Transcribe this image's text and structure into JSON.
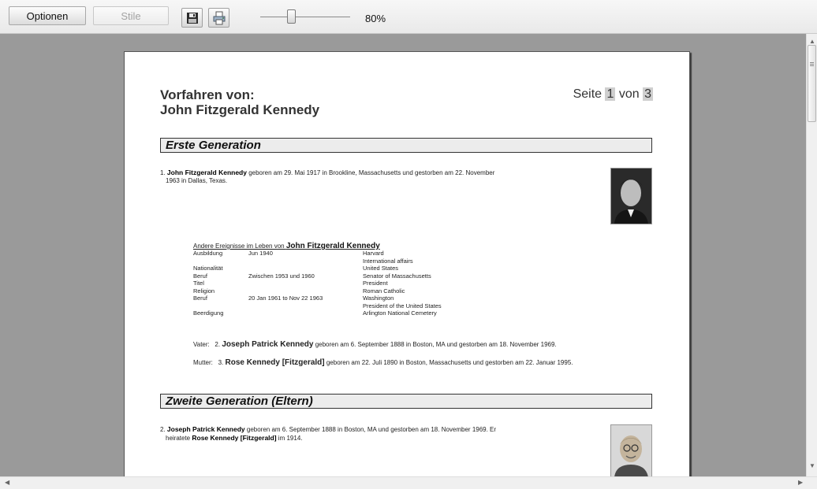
{
  "toolbar": {
    "options_label": "Optionen",
    "styles_label": "Stile",
    "save_icon": "floppy-disk-icon",
    "print_icon": "printer-icon",
    "zoom_value": 0.8,
    "zoom_label": "80%"
  },
  "document": {
    "title_prefix": "Vorfahren von:",
    "title_name": "John Fitzgerald Kennedy",
    "page_word": "Seite",
    "page_current": "1",
    "page_of": "von",
    "page_total": "3",
    "generations": [
      {
        "heading": "Erste Generation",
        "person": {
          "number": "1.",
          "name": "John Fitzgerald Kennedy",
          "text_line1": " geboren am 29. Mai 1917 in Brookline, Massachusetts und gestorben am 22. November",
          "text_line2": "1963 in Dallas, Texas."
        },
        "events_heading_prefix": "Andere Ereignisse im Leben von ",
        "events_heading_name": "John Fitzgerald Kennedy",
        "events": [
          {
            "type": "Ausbildung",
            "date": "Jun 1940",
            "value": "Harvard"
          },
          {
            "type": "",
            "date": "",
            "value": "International affairs"
          },
          {
            "type": "Nationalität",
            "date": "",
            "value": "United States"
          },
          {
            "type": "Beruf",
            "date": "Zwischen 1953 und 1960",
            "value": "Senator of Massachusetts"
          },
          {
            "type": "Titel",
            "date": "",
            "value": "President"
          },
          {
            "type": "Religion",
            "date": "",
            "value": "Roman Catholic"
          },
          {
            "type": "Beruf",
            "date": "20 Jan 1961 to Nov 22 1963",
            "value": "Washington"
          },
          {
            "type": "",
            "date": "",
            "value": "President of the United States"
          },
          {
            "type": "Beerdigung",
            "date": "",
            "value": "Arlington National Cemetery"
          }
        ],
        "father_label": "Vater:",
        "father_number": "2.",
        "father_name": "Joseph Patrick Kennedy",
        "father_text": " geboren am 6. September 1888 in Boston, MA und gestorben am 18. November 1969.",
        "mother_label": "Mutter:",
        "mother_number": "3.",
        "mother_name": "Rose Kennedy [Fitzgerald]",
        "mother_text": " geboren am 22. Juli 1890 in Boston, Massachusetts und gestorben am 22. Januar 1995."
      },
      {
        "heading": "Zweite Generation (Eltern)",
        "person": {
          "number": "2.",
          "name": "Joseph Patrick Kennedy",
          "text_line1": " geboren am 6. September 1888 in Boston, MA und gestorben am 18. November 1969. Er",
          "text_line2_prefix": "heiratete ",
          "spouse_name": "Rose Kennedy [Fitzgerald]",
          "text_line2_suffix": " im 1914."
        }
      }
    ]
  }
}
